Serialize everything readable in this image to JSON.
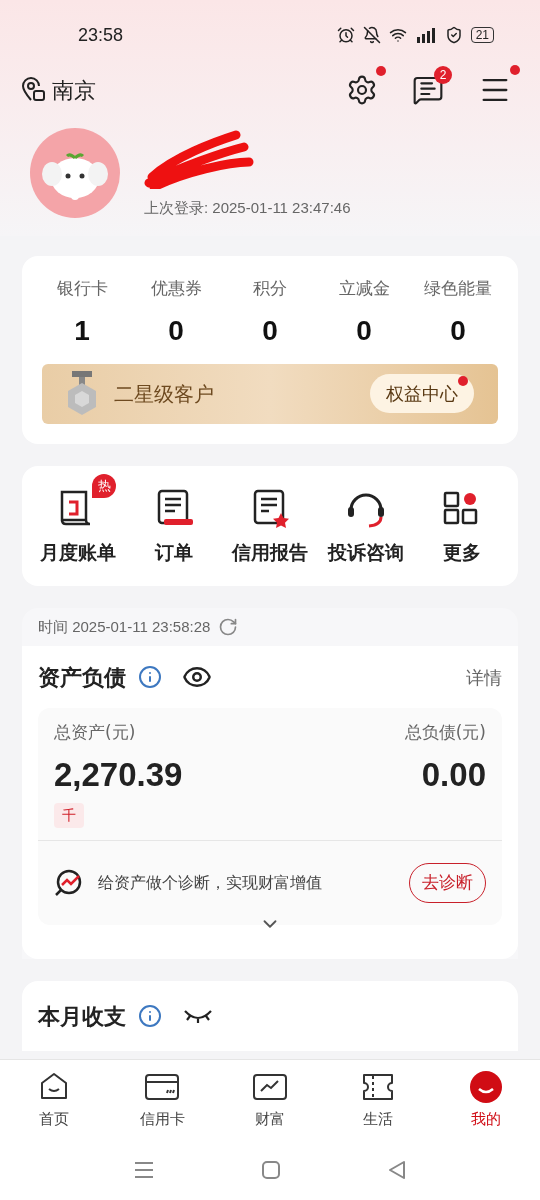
{
  "status_bar": {
    "time": "23:58",
    "battery": "21"
  },
  "header": {
    "city": "南京",
    "messages_badge": "2",
    "settings_dot": true,
    "menu_dot": true
  },
  "profile": {
    "last_login": "上次登录: 2025-01-11 23:47:46"
  },
  "stats": [
    {
      "label": "银行卡",
      "value": "1"
    },
    {
      "label": "优惠券",
      "value": "0"
    },
    {
      "label": "积分",
      "value": "0"
    },
    {
      "label": "立减金",
      "value": "0"
    },
    {
      "label": "绿色能量",
      "value": "0"
    }
  ],
  "tier": {
    "label": "二星级客户",
    "button": "权益中心",
    "dot": true
  },
  "shortcuts": [
    {
      "kind": "bill",
      "label": "月度账单",
      "badge": "热"
    },
    {
      "kind": "order",
      "label": "订单"
    },
    {
      "kind": "report",
      "label": "信用报告"
    },
    {
      "kind": "support",
      "label": "投诉咨询"
    },
    {
      "kind": "more",
      "label": "更多"
    }
  ],
  "assets": {
    "timestamp": "时间 2025-01-11 23:58:28",
    "title": "资产负债",
    "visible": true,
    "details": "详情",
    "total_assets_label": "总资产(元)",
    "total_assets": "2,270.39",
    "unit_tag": "千",
    "total_liabilities_label": "总负债(元)",
    "total_liabilities": "0.00",
    "diagnosis_text": "给资产做个诊断，实现财富增值",
    "diagnosis_button": "去诊断"
  },
  "monthly": {
    "title": "本月收支",
    "visible": false
  },
  "tab_bar": [
    {
      "kind": "home",
      "label": "首页",
      "selected": false
    },
    {
      "kind": "card",
      "label": "信用卡",
      "selected": false
    },
    {
      "kind": "wealth",
      "label": "财富",
      "selected": false
    },
    {
      "kind": "life",
      "label": "生活",
      "selected": false
    },
    {
      "kind": "me",
      "label": "我的",
      "selected": true
    }
  ]
}
